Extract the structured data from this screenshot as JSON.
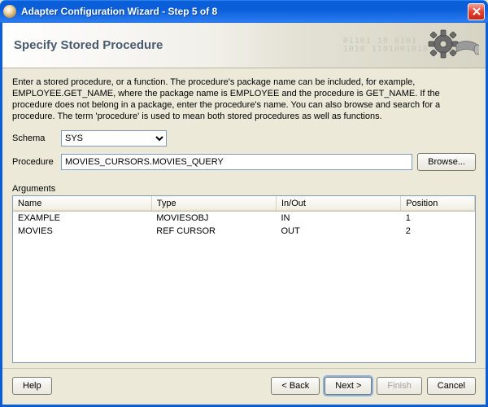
{
  "window": {
    "title": "Adapter Configuration Wizard - Step 5 of 8"
  },
  "banner": {
    "heading": "Specify Stored Procedure"
  },
  "description": "Enter a stored procedure, or a function. The procedure's package name can be included, for example, EMPLOYEE.GET_NAME, where the package name is EMPLOYEE and the procedure is GET_NAME.  If the procedure does not belong in a package, enter the procedure's name. You can also browse and search for a procedure. The term 'procedure' is used to mean both stored procedures as well as functions.",
  "labels": {
    "schema": "Schema",
    "procedure": "Procedure",
    "arguments": "Arguments"
  },
  "schema": {
    "selected": "SYS"
  },
  "procedure": {
    "value": "MOVIES_CURSORS.MOVIES_QUERY"
  },
  "browse_label": "Browse...",
  "args": {
    "headers": {
      "name": "Name",
      "type": "Type",
      "inout": "In/Out",
      "position": "Position"
    },
    "rows": [
      {
        "name": "EXAMPLE",
        "type": "MOVIESOBJ",
        "inout": "IN",
        "position": "1"
      },
      {
        "name": "MOVIES",
        "type": "REF CURSOR",
        "inout": "OUT",
        "position": "2"
      }
    ]
  },
  "buttons": {
    "help": "Help",
    "back": "< Back",
    "next": "Next >",
    "finish": "Finish",
    "cancel": "Cancel"
  }
}
